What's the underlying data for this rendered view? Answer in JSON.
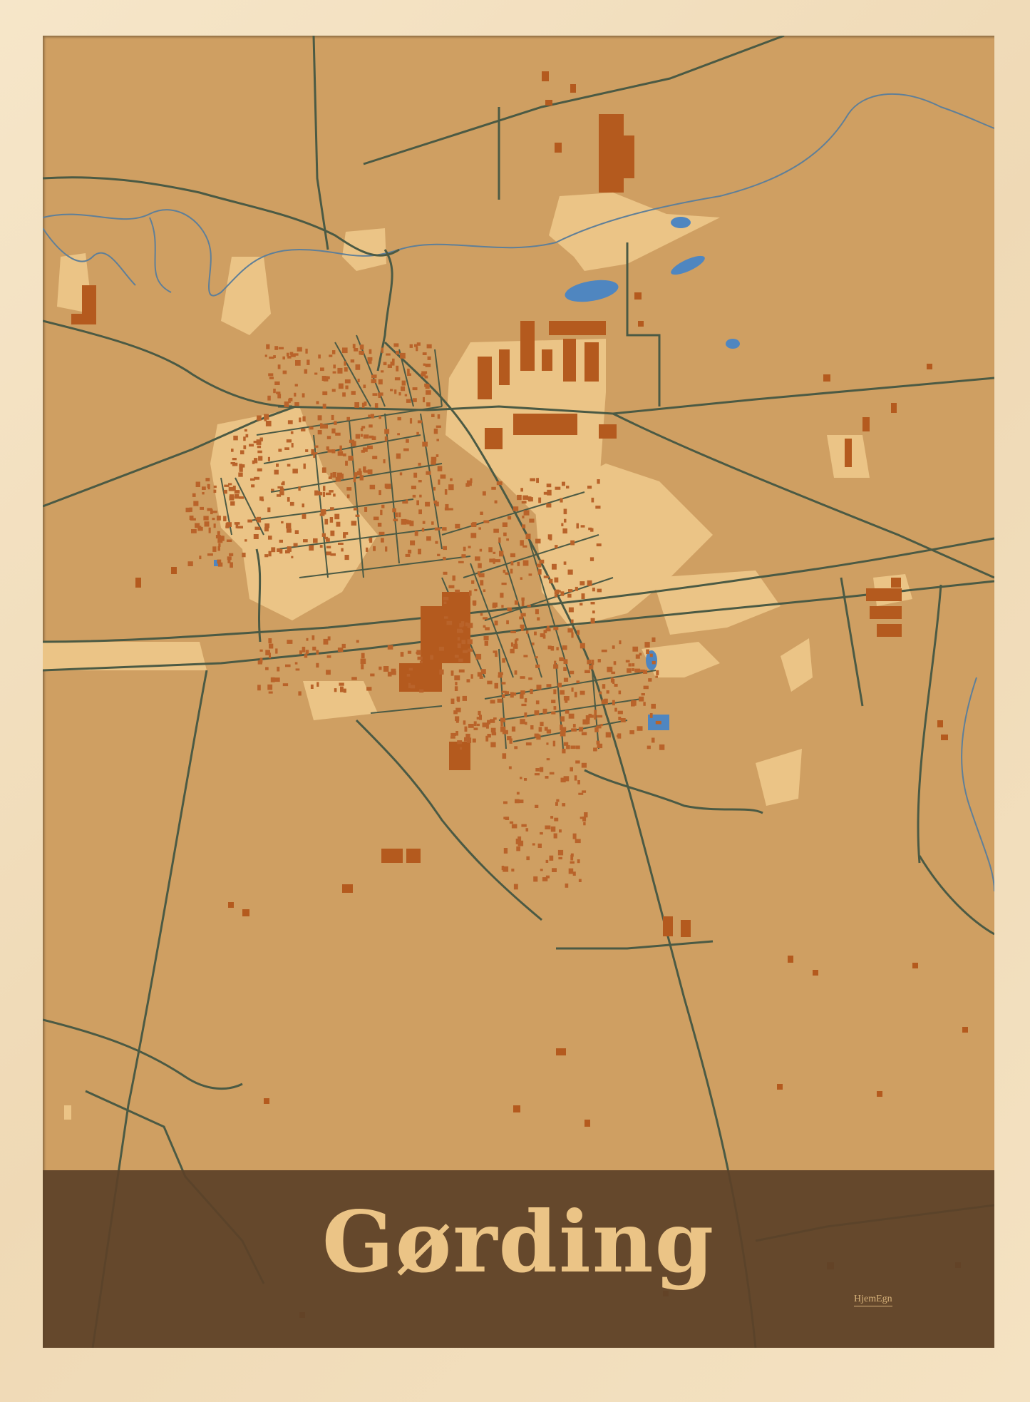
{
  "poster": {
    "town_name": "Gørding",
    "brand_mark": "HjemEgn"
  },
  "colors": {
    "frame": "#f3dfbf",
    "land": "#cf9f62",
    "built_area": "#ebc486",
    "buildings": "#b45a1e",
    "roads": "#4b5a44",
    "water": "#4f86c0",
    "banner": "#5c4228",
    "title_text": "#ebc486"
  }
}
